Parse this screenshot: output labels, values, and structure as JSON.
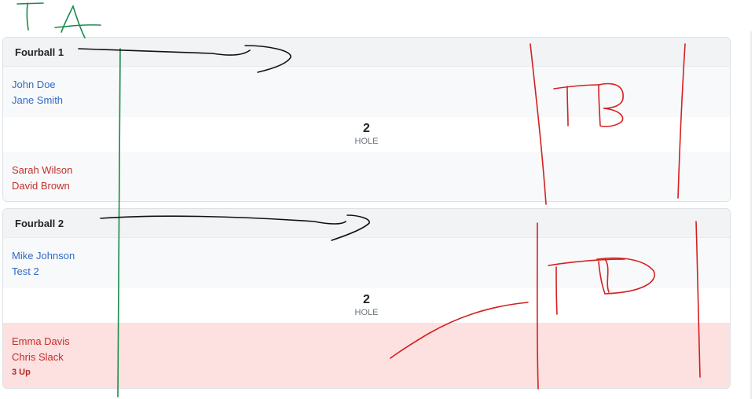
{
  "fourballs": [
    {
      "title": "Fourball 1",
      "team_a": [
        "John Doe",
        "Jane Smith"
      ],
      "hole_number": "2",
      "hole_label": "HOLE",
      "team_b": [
        "Sarah Wilson",
        "David Brown"
      ],
      "status": ""
    },
    {
      "title": "Fourball 2",
      "team_a": [
        "Mike Johnson",
        "Test 2"
      ],
      "hole_number": "2",
      "hole_label": "HOLE",
      "team_b": [
        "Emma Davis",
        "Chris Slack"
      ],
      "status": "3 Up"
    }
  ],
  "annotations": {
    "team_a_label": "TA",
    "team_b_label": "TB",
    "team_a_color": "#1a8a4a",
    "team_b_color": "#d42020",
    "arrow_color": "#111111"
  },
  "colors": {
    "team_a_text": "#2f6bc5",
    "team_b_text": "#c0302b",
    "winning_highlight": "#fde0e0"
  }
}
